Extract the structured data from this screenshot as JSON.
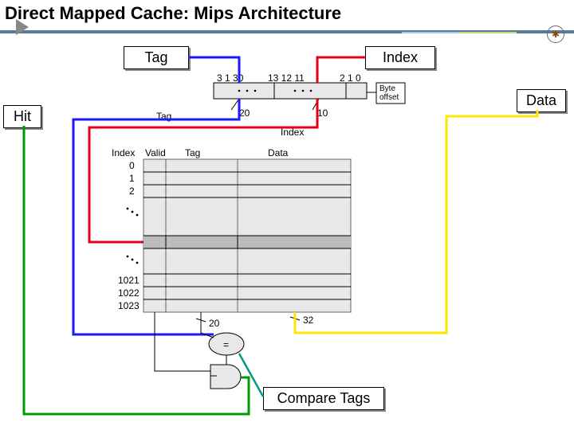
{
  "title": "Direct Mapped Cache: Mips Architecture",
  "labels": {
    "tag": "Tag",
    "index": "Index",
    "hit": "Hit",
    "data": "Data",
    "compare": "Compare Tags",
    "byte_offset": "Byte\noffset",
    "eq": "="
  },
  "address": {
    "msb": "3 1 30",
    "split_hi": "13 12 11",
    "split_lo": "2 1 0",
    "tag_bits": "20",
    "index_bits": "10",
    "field_tag": "Tag",
    "field_index": "Index"
  },
  "cache_table": {
    "headers": {
      "index": "Index",
      "valid": "Valid",
      "tag": "Tag",
      "data": "Data"
    },
    "row_labels": [
      "0",
      "1",
      "2",
      "",
      "",
      "",
      "",
      "",
      "",
      "1021",
      "1022",
      "1023"
    ],
    "dots_rows": [
      3,
      4,
      5,
      6,
      7,
      8
    ],
    "selected_row": 6,
    "tag_out_bits": "20",
    "data_out_bits": "32"
  }
}
